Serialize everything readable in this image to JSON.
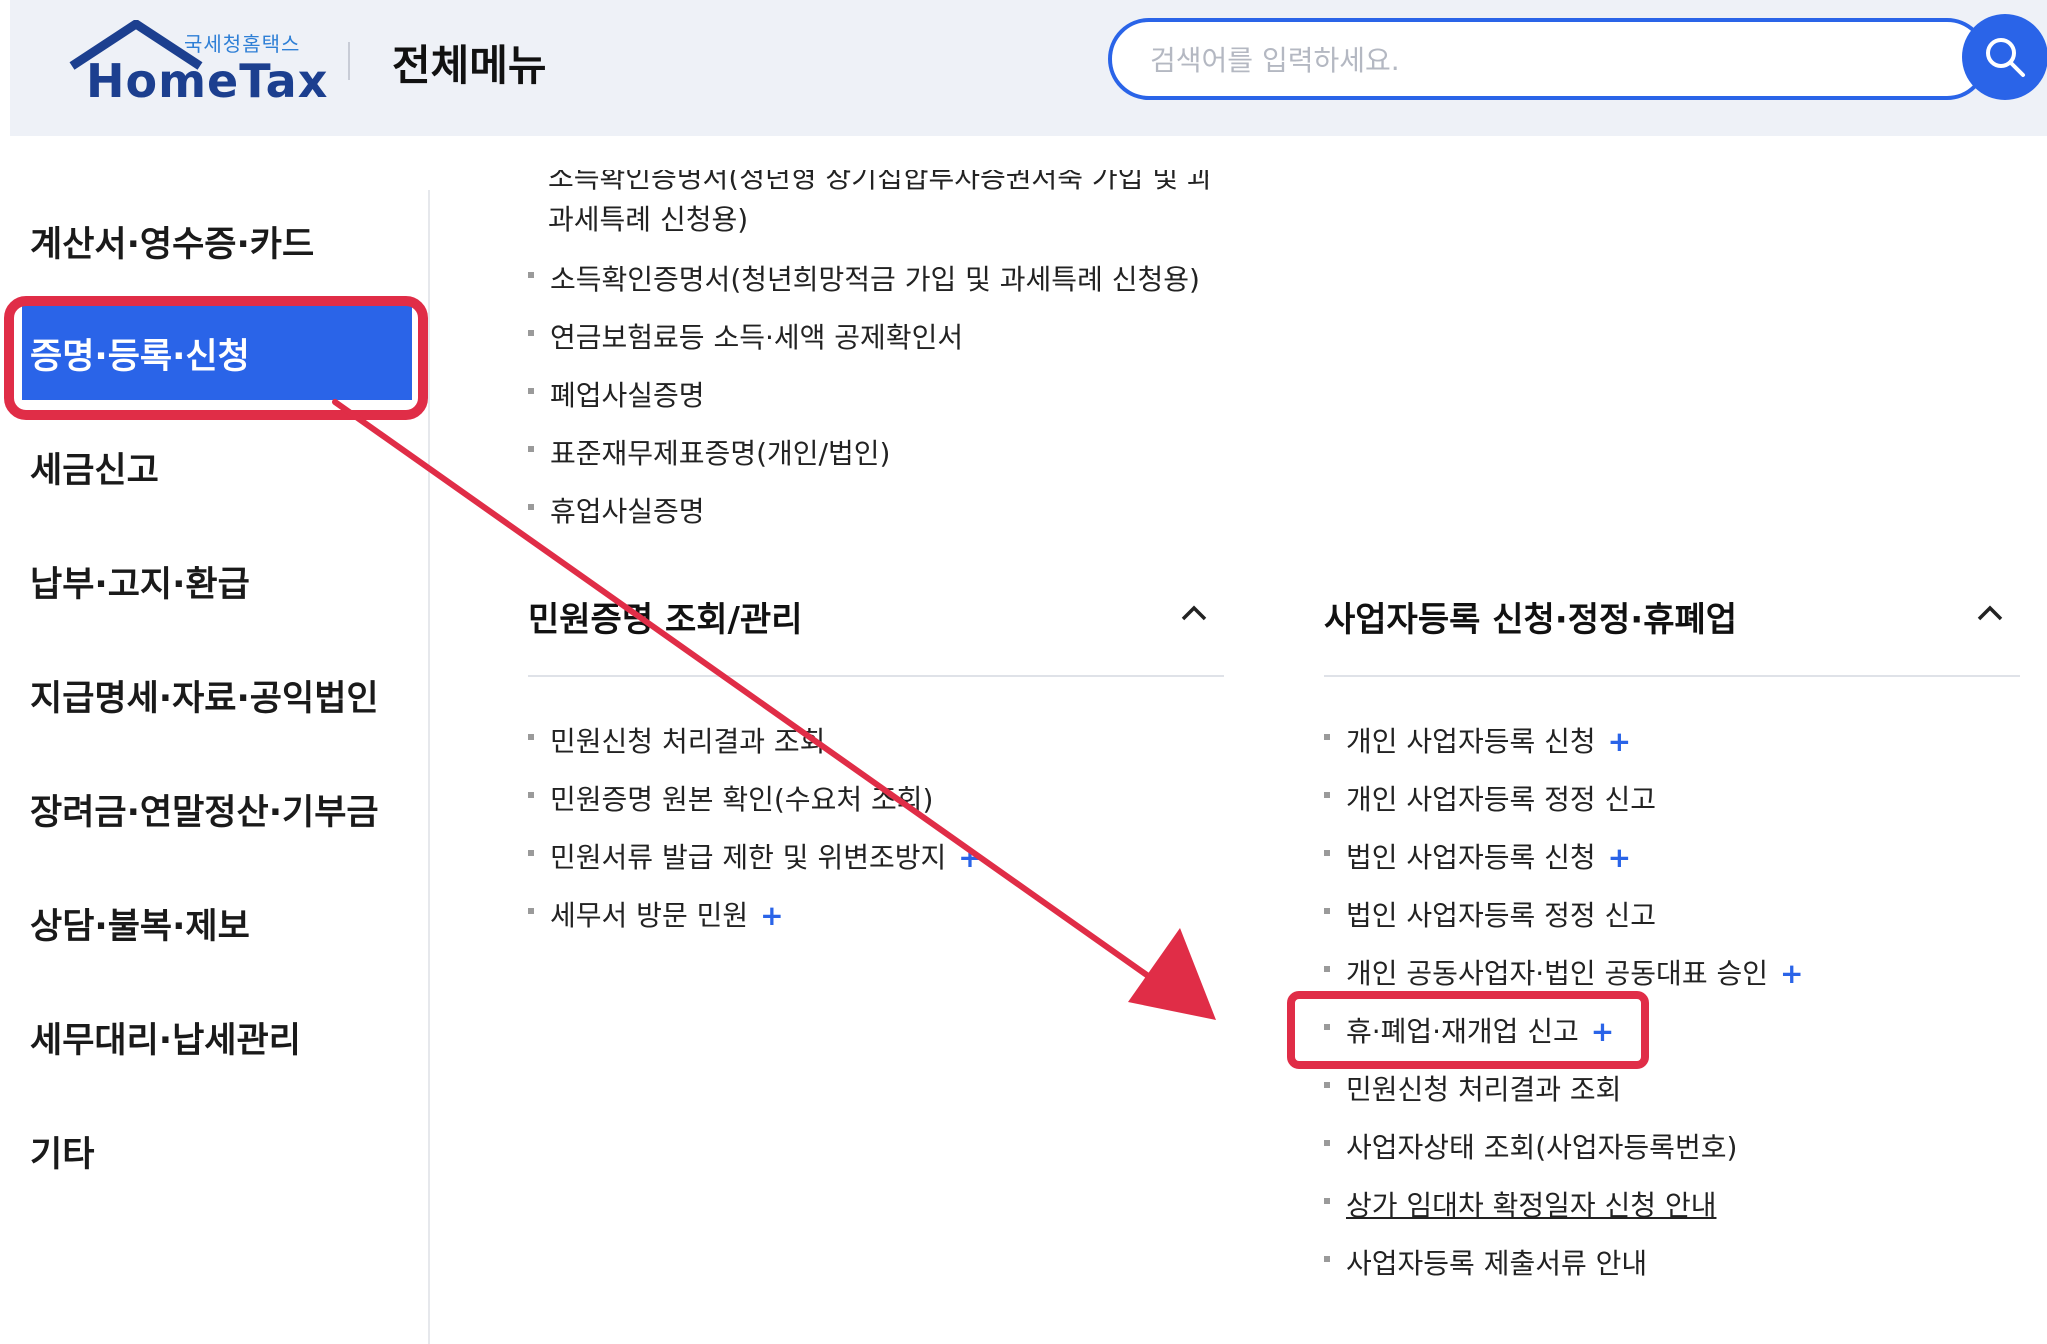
{
  "header": {
    "logo_small": "국세청홈택스",
    "logo_big": "HomeTax",
    "page_title": "전체메뉴",
    "search_placeholder": "검색어를 입력하세요.",
    "search_icon": "search-icon"
  },
  "left_menu": {
    "items": [
      {
        "label": "계산서·영수증·카드"
      },
      {
        "label": "증명·등록·신청",
        "active": true
      },
      {
        "label": "세금신고"
      },
      {
        "label": "납부·고지·환급"
      },
      {
        "label": "지급명세·자료·공익법인"
      },
      {
        "label": "장려금·연말정산·기부금"
      },
      {
        "label": "상담·불복·제보"
      },
      {
        "label": "세무대리·납세관리"
      },
      {
        "label": "기타"
      }
    ]
  },
  "content": {
    "clipped_top": "소득확인증명서(청년형 장기집합투자증권저축 가입 및 과세특례 신청용)",
    "top_continuation": "과세특례 신청용)",
    "top_list": [
      {
        "label": "소득확인증명서(청년희망적금 가입 및 과세특례 신청용)"
      },
      {
        "label": "연금보험료등 소득·세액 공제확인서"
      },
      {
        "label": "폐업사실증명"
      },
      {
        "label": "표준재무제표증명(개인/법인)"
      },
      {
        "label": "휴업사실증명"
      }
    ],
    "section_left": {
      "title": "민원증명 조회/관리",
      "icon": "chevron-up-icon",
      "items": [
        {
          "label": "민원신청 처리결과 조회",
          "plus": ""
        },
        {
          "label": "민원증명 원본 확인(수요처 조회)",
          "plus": ""
        },
        {
          "label": "민원서류 발급 제한 및 위변조방지",
          "plus": "+"
        },
        {
          "label": "세무서 방문 민원",
          "plus": "+"
        }
      ]
    },
    "section_right": {
      "title": "사업자등록 신청·정정·휴폐업",
      "icon": "chevron-up-icon",
      "items": [
        {
          "label": "개인 사업자등록 신청",
          "plus": "+"
        },
        {
          "label": "개인 사업자등록 정정 신고",
          "plus": ""
        },
        {
          "label": "법인 사업자등록 신청",
          "plus": "+"
        },
        {
          "label": "법인 사업자등록 정정 신고",
          "plus": ""
        },
        {
          "label": "개인 공동사업자·법인 공동대표 승인",
          "plus": "+"
        },
        {
          "label": "휴·폐업·재개업 신고",
          "plus": "+",
          "highlighted": true
        },
        {
          "label": "민원신청 처리결과 조회",
          "plus": ""
        },
        {
          "label": "사업자상태 조회(사업자등록번호)",
          "plus": ""
        },
        {
          "label": "상가 임대차 확정일자 신청 안내",
          "plus": "",
          "underlined": true
        },
        {
          "label": "사업자등록 제출서류 안내",
          "plus": ""
        }
      ]
    }
  },
  "annotation": {
    "color": "#e02d47"
  }
}
